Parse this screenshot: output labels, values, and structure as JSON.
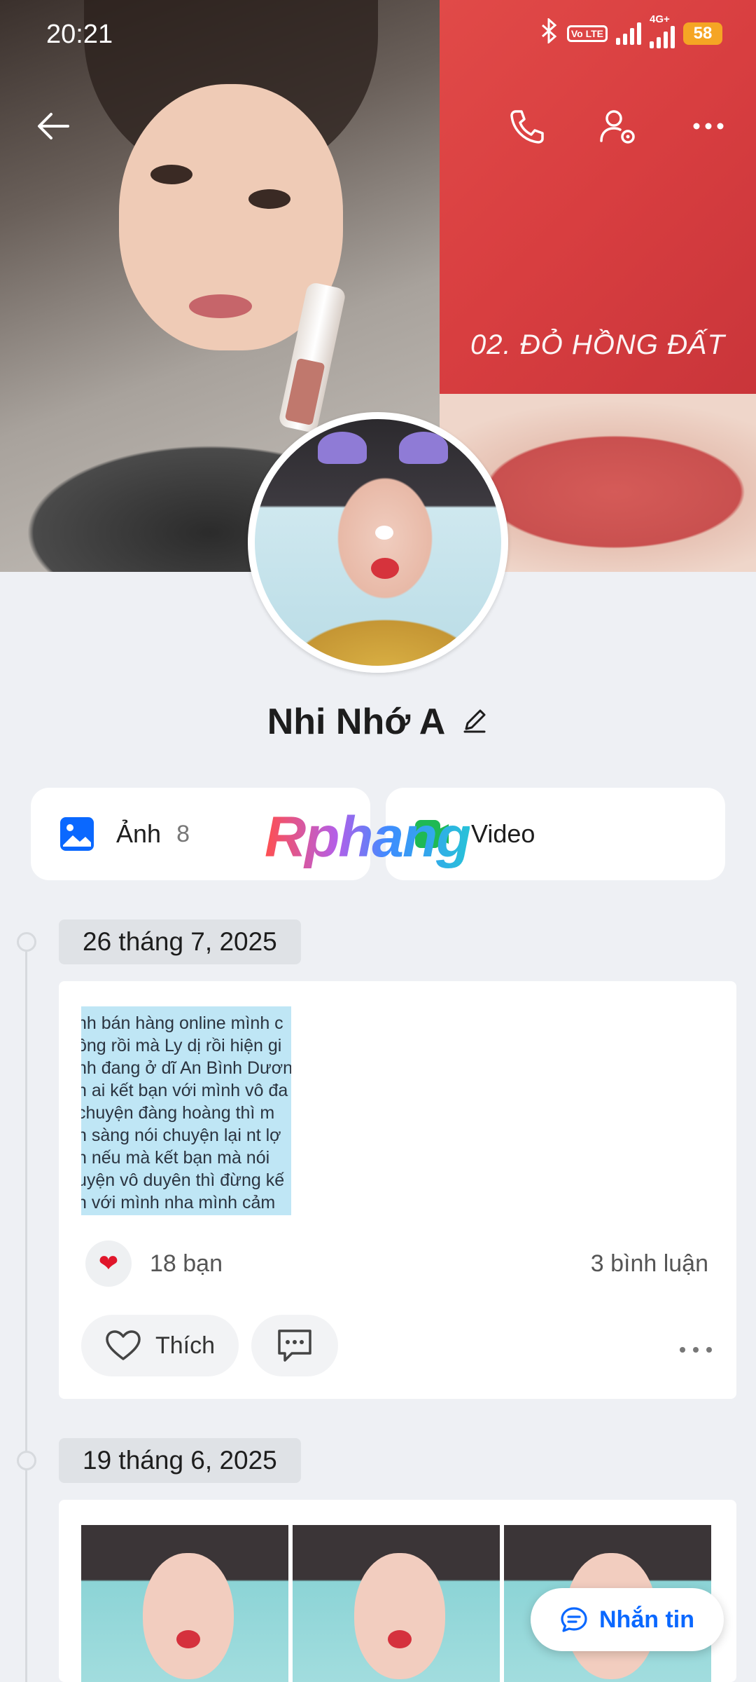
{
  "status_bar": {
    "time": "20:21",
    "volte": "Vo LTE",
    "network": "4G+",
    "battery": "58"
  },
  "cover": {
    "caption": "02. ĐỎ HỒNG ĐẤT"
  },
  "profile": {
    "name": "Nhi Nhớ A"
  },
  "media": {
    "photos_label": "Ảnh",
    "photos_count": "8",
    "video_label": "Video"
  },
  "watermark": "Rphang",
  "timeline": {
    "posts": [
      {
        "date": "26 tháng 7, 2025",
        "text_lines": [
          "nh bán hàng online mình c",
          "ông rồi mà Ly dị rồi hiện gi",
          "nh đang ở dĩ An Bình Dươn",
          "n ai kết bạn với mình vô đa",
          "chuyện đàng hoàng thì m",
          "n sàng nói chuyện lại nt lợ",
          "n nếu mà kết bạn mà nói",
          "uyện vô duyên thì đừng kế",
          "n với mình nha mình cảm"
        ],
        "reactions": "18 bạn",
        "comments": "3 bình luận",
        "like_label": "Thích"
      },
      {
        "date": "19 tháng 6, 2025"
      }
    ]
  },
  "message_button": "Nhắn tin",
  "colors": {
    "accent": "#0a68ff",
    "battery": "#f5a524",
    "heart": "#e0162b"
  }
}
